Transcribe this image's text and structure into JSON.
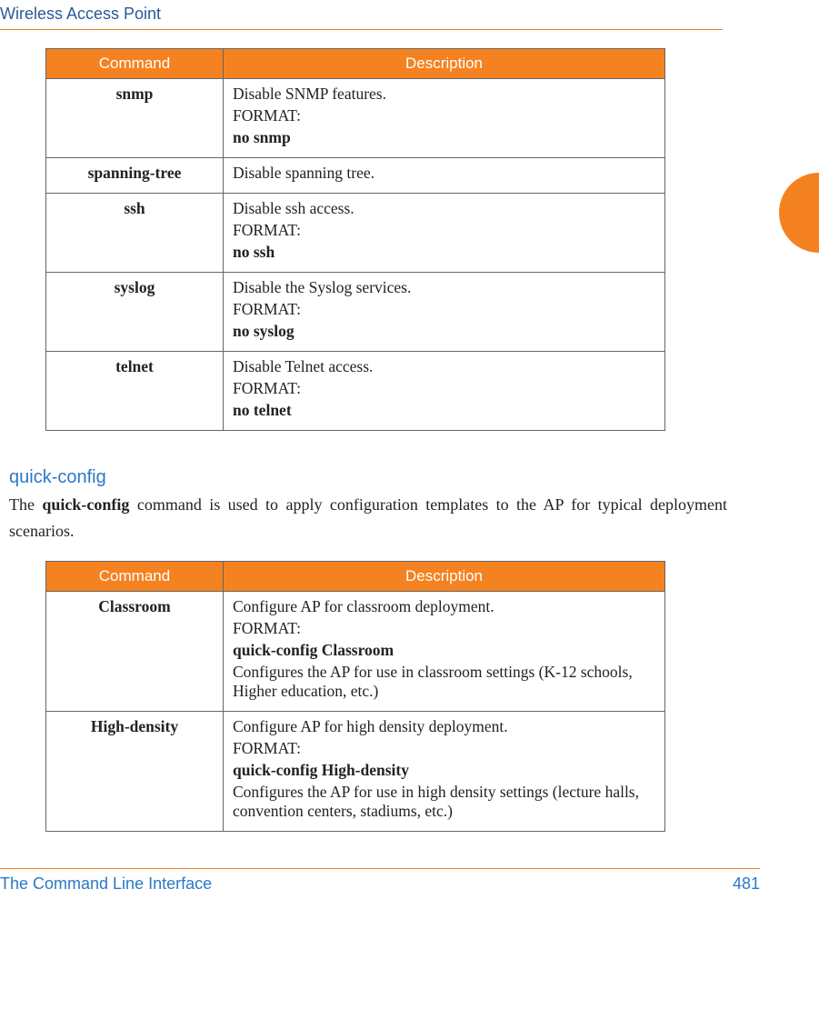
{
  "header": {
    "title": "Wireless Access Point"
  },
  "table1": {
    "headers": {
      "command": "Command",
      "description": "Description"
    },
    "rows": [
      {
        "command": "snmp",
        "line1": "Disable SNMP features.",
        "line2": "FORMAT:",
        "line3": "no snmp"
      },
      {
        "command": "spanning-tree",
        "line1": "Disable spanning tree."
      },
      {
        "command": "ssh",
        "line1": "Disable ssh access.",
        "line2": "FORMAT:",
        "line3": "no ssh"
      },
      {
        "command": "syslog",
        "line1": "Disable the Syslog services.",
        "line2": "FORMAT:",
        "line3": "no syslog"
      },
      {
        "command": "telnet",
        "line1": "Disable Telnet access.",
        "line2": "FORMAT:",
        "line3": "no telnet"
      }
    ]
  },
  "section": {
    "title": "quick-config",
    "intro_before": "The ",
    "intro_bold": "quick-config",
    "intro_after": " command is used to apply configuration templates to the AP for typical deployment scenarios."
  },
  "table2": {
    "headers": {
      "command": "Command",
      "description": "Description"
    },
    "rows": [
      {
        "command": "Classroom",
        "line1": "Configure AP for classroom deployment.",
        "line2": "FORMAT:",
        "line3": "quick-config Classroom",
        "line4": "Configures the AP for use in classroom settings (K-12 schools, Higher education, etc.)"
      },
      {
        "command": "High-density",
        "line1": "Configure AP for high density deployment.",
        "line2": "FORMAT:",
        "line3": "quick-config High-density",
        "line4": "Configures the AP for use in high density settings (lecture halls, convention centers, stadiums, etc.)"
      }
    ]
  },
  "footer": {
    "left": "The Command Line Interface",
    "right": "481"
  }
}
